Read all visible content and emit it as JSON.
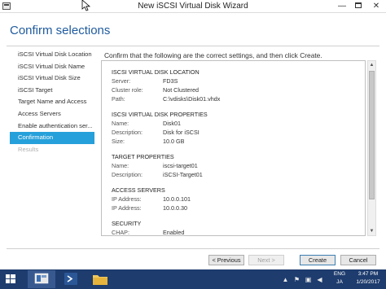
{
  "window": {
    "title": "New iSCSI Virtual Disk Wizard",
    "minimize_glyph": "—",
    "close_glyph": "✕"
  },
  "header": {
    "title": "Confirm selections"
  },
  "nav": {
    "items": [
      {
        "label": "iSCSI Virtual Disk Location",
        "state": "normal"
      },
      {
        "label": "iSCSI Virtual Disk Name",
        "state": "normal"
      },
      {
        "label": "iSCSI Virtual Disk Size",
        "state": "normal"
      },
      {
        "label": "iSCSI Target",
        "state": "normal"
      },
      {
        "label": "Target Name and Access",
        "state": "normal"
      },
      {
        "label": "Access Servers",
        "state": "normal"
      },
      {
        "label": "Enable authentication ser...",
        "state": "normal"
      },
      {
        "label": "Confirmation",
        "state": "selected"
      },
      {
        "label": "Results",
        "state": "disabled"
      }
    ]
  },
  "content": {
    "instruction": "Confirm that the following are the correct settings, and then click Create.",
    "sections": [
      {
        "title": "ISCSI VIRTUAL DISK LOCATION",
        "rows": [
          {
            "label": "Server:",
            "value": "FD3S"
          },
          {
            "label": "Cluster role:",
            "value": "Not Clustered"
          },
          {
            "label": "Path:",
            "value": "C:\\vdisks\\Disk01.vhdx"
          }
        ]
      },
      {
        "title": "ISCSI VIRTUAL DISK PROPERTIES",
        "rows": [
          {
            "label": "Name:",
            "value": "Disk01"
          },
          {
            "label": "Description:",
            "value": "Disk for iSCSI"
          },
          {
            "label": "Size:",
            "value": "10.0 GB"
          }
        ]
      },
      {
        "title": "TARGET PROPERTIES",
        "rows": [
          {
            "label": "Name:",
            "value": "iscsi-target01"
          },
          {
            "label": "Description:",
            "value": "iSCSI-Target01"
          }
        ]
      },
      {
        "title": "ACCESS SERVERS",
        "rows": [
          {
            "label": "IP Address:",
            "value": "10.0.0.101"
          },
          {
            "label": "IP Address:",
            "value": "10.0.0.30"
          }
        ]
      },
      {
        "title": "SECURITY",
        "rows": [
          {
            "label": "CHAP:",
            "value": "Enabled"
          }
        ]
      }
    ]
  },
  "buttons": {
    "previous": "< Previous",
    "next": "Next >",
    "create": "Create",
    "cancel": "Cancel"
  },
  "scrollbar": {
    "up_glyph": "▲",
    "down_glyph": "▼"
  },
  "taskbar": {
    "language_line1": "ENG",
    "language_line2": "JA",
    "time": "3:47 PM",
    "date": "1/20/2017",
    "tray_icons": [
      "chevron-up-icon",
      "flag-icon",
      "network-icon",
      "speaker-icon"
    ],
    "tray_glyphs": [
      "▲",
      "⚑",
      "▣",
      "◀"
    ],
    "colors": {
      "taskbar": "#1e3c6e",
      "selection": "#26a0da",
      "header": "#1e5a9e"
    }
  }
}
